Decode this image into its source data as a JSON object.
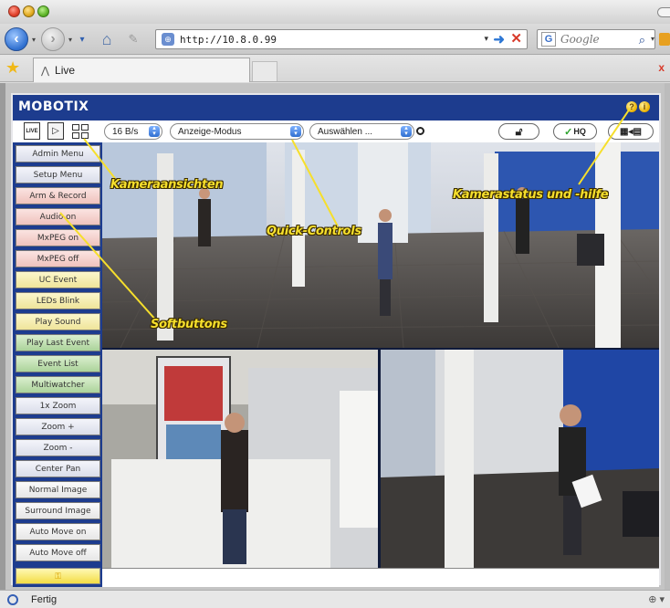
{
  "browser": {
    "address": "http://10.8.0.99",
    "search_placeholder": "Google",
    "search_engine_icon": "G",
    "tab_title": "Live",
    "tab_icon": "⋀",
    "status_text": "Fertig",
    "status_right": "⊕ ▾"
  },
  "camera_ui": {
    "logo": "MOBOTIX",
    "help_icon": "?",
    "info_icon": "i",
    "view_live_label": "LIVE",
    "frame_rate": "16 B/s",
    "display_mode": "Anzeige-Modus",
    "choose": "Auswählen ...",
    "hq_label": "HQ",
    "softbuttons": [
      {
        "label": "Admin Menu",
        "color": "blue"
      },
      {
        "label": "Setup Menu",
        "color": "blue"
      },
      {
        "label": "Arm & Record",
        "color": "red"
      },
      {
        "label": "Audio on",
        "color": "red"
      },
      {
        "label": "MxPEG on",
        "color": "red"
      },
      {
        "label": "MxPEG off",
        "color": "red"
      },
      {
        "label": "UC Event",
        "color": "yellow"
      },
      {
        "label": "LEDs Blink",
        "color": "yellow"
      },
      {
        "label": "Play Sound",
        "color": "yellow"
      },
      {
        "label": "Play Last Event",
        "color": "green"
      },
      {
        "label": "Event List",
        "color": "green"
      },
      {
        "label": "Multiwatcher",
        "color": "green"
      },
      {
        "label": "1x Zoom",
        "color": "blue"
      },
      {
        "label": "Zoom +",
        "color": "blue"
      },
      {
        "label": "Zoom -",
        "color": "blue"
      },
      {
        "label": "Center Pan",
        "color": "blue"
      },
      {
        "label": "Normal Image",
        "color": "white"
      },
      {
        "label": "Surround Image",
        "color": "white"
      },
      {
        "label": "Auto Move on",
        "color": "white"
      },
      {
        "label": "Auto Move off",
        "color": "white"
      }
    ]
  },
  "callouts": {
    "views": "Kameraansichten",
    "quick": "Quick-Controls",
    "status": "Kamerastatus und -hilfe",
    "soft": "Softbuttons"
  },
  "colors": {
    "mobotix_blue": "#1d3c8e",
    "callout_yellow": "#f6df2c"
  }
}
